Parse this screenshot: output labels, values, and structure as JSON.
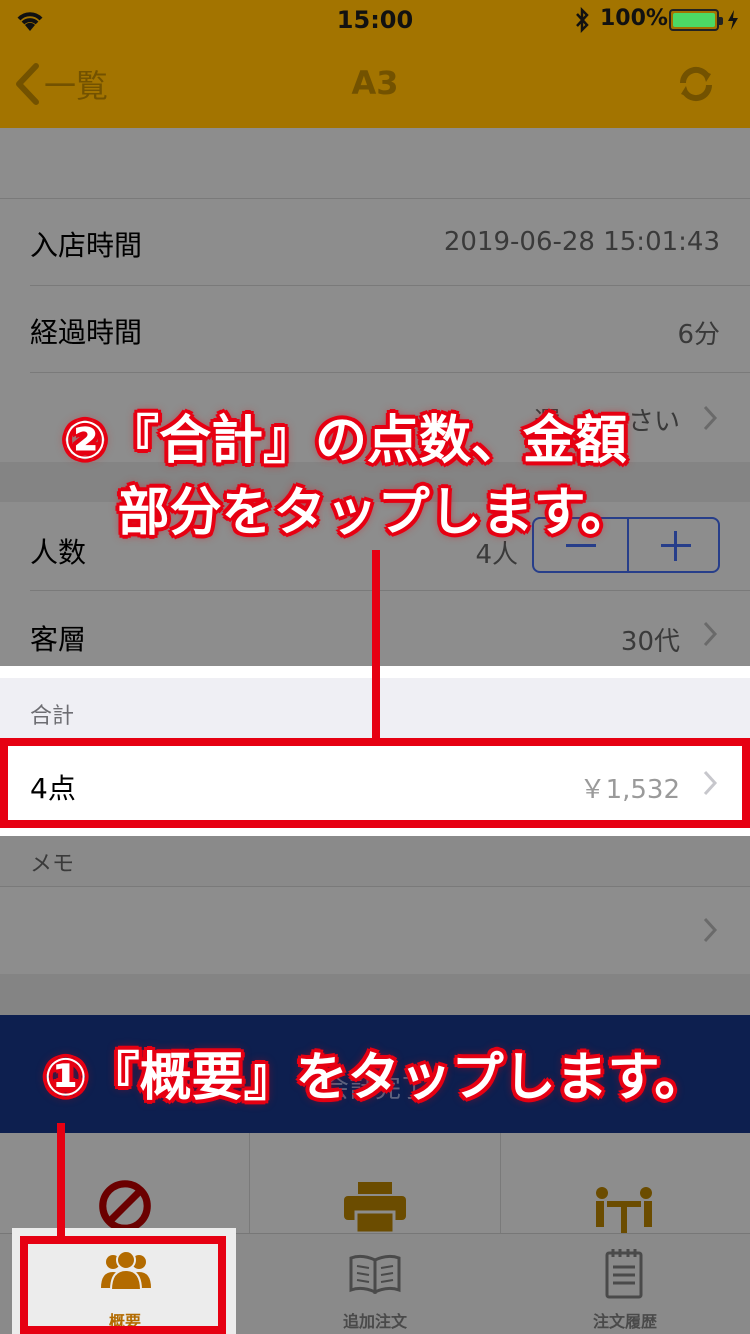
{
  "status_bar": {
    "time": "15:00",
    "battery": "100%"
  },
  "nav": {
    "back_label": "一覧",
    "title": "A3"
  },
  "details": {
    "entry_time_label": "入店時間",
    "entry_time_value": "2019-06-28 15:01:43",
    "elapsed_label": "経過時間",
    "elapsed_value": "6分",
    "select_partial_left": "選",
    "select_partial_right": "さい",
    "people_label": "人数",
    "people_value": "4人",
    "customer_label": "客層",
    "customer_value": "30代"
  },
  "total": {
    "header": "合計",
    "count": "4点",
    "amount": "￥1,532"
  },
  "memo": {
    "header": "メモ"
  },
  "banner_hidden_text": "会計完了",
  "tabs": [
    {
      "label": "概要",
      "icon": "people-icon",
      "active": true
    },
    {
      "label": "追加注文",
      "icon": "book-icon",
      "active": false
    },
    {
      "label": "注文履歴",
      "icon": "notepad-icon",
      "active": false
    }
  ],
  "actions": [
    {
      "icon": "prohibit-icon"
    },
    {
      "icon": "printer-icon"
    },
    {
      "icon": "table-seats-icon"
    }
  ],
  "callouts": {
    "step2_line1": "②『合計』の点数、金額",
    "step2_line2": "部分をタップします。",
    "step1": "①『概要』をタップします。"
  },
  "colors": {
    "accent": "#a37400",
    "highlight": "#e60012",
    "stepper": "#273e8a",
    "banner": "#0d1f4f"
  }
}
